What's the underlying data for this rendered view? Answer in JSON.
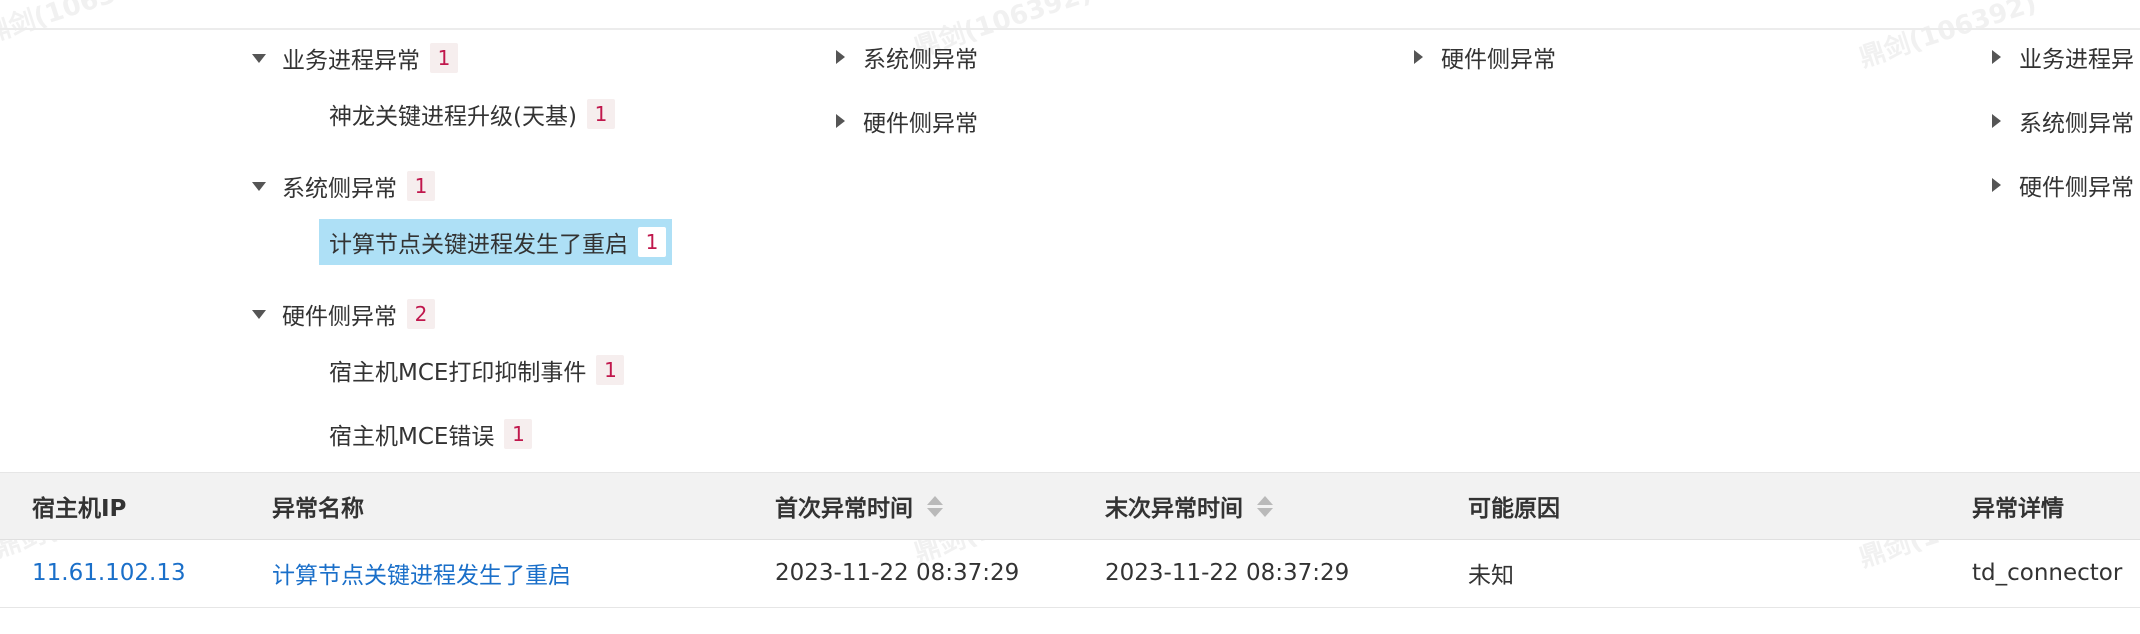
{
  "tree": {
    "col1": [
      {
        "label": "业务进程异常",
        "count": "1",
        "expanded": true
      },
      {
        "label": "神龙关键进程升级(天基)",
        "count": "1"
      },
      {
        "label": "系统侧异常",
        "count": "1",
        "expanded": true
      },
      {
        "label": "计算节点关键进程发生了重启",
        "count": "1",
        "selected": true
      },
      {
        "label": "硬件侧异常",
        "count": "2",
        "expanded": true
      },
      {
        "label": "宿主机MCE打印抑制事件",
        "count": "1"
      },
      {
        "label": "宿主机MCE错误",
        "count": "1"
      }
    ],
    "col2": [
      {
        "label": "系统侧异常"
      },
      {
        "label": "硬件侧异常"
      }
    ],
    "col3": [
      {
        "label": "硬件侧异常"
      }
    ],
    "col4": [
      {
        "label": "业务进程异"
      },
      {
        "label": "系统侧异常"
      },
      {
        "label": "硬件侧异常"
      }
    ]
  },
  "table": {
    "headers": {
      "ip": "宿主机IP",
      "name": "异常名称",
      "first": "首次异常时间",
      "last": "末次异常时间",
      "reason": "可能原因",
      "detail": "异常详情"
    },
    "rows": [
      {
        "ip": "11.61.102.13",
        "name": "计算节点关键进程发生了重启",
        "first": "2023-11-22 08:37:29",
        "last": "2023-11-22 08:37:29",
        "reason": "未知",
        "detail": "td_connector"
      }
    ]
  },
  "watermark": "鼎剑(106392)",
  "colors": {
    "selected_bg": "#aee0f6",
    "badge_text": "#c0174c",
    "link": "#1a6fc9",
    "header_bg": "#f2f2f2"
  },
  "icons": {
    "expanded": "caret-down-icon",
    "collapsed": "caret-right-icon",
    "sort": "sort-icon"
  }
}
